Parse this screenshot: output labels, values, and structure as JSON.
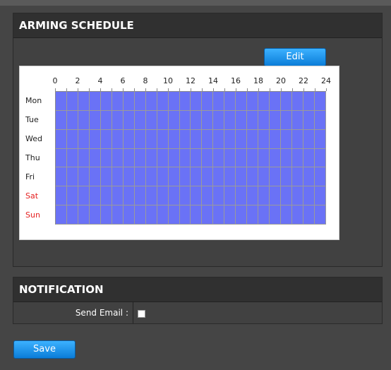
{
  "arming": {
    "title": "ARMING SCHEDULE",
    "edit_label": "Edit",
    "hours": [
      "0",
      "2",
      "4",
      "6",
      "8",
      "10",
      "12",
      "14",
      "16",
      "18",
      "20",
      "22",
      "24"
    ],
    "days": [
      {
        "label": "Mon",
        "weekend": false
      },
      {
        "label": "Tue",
        "weekend": false
      },
      {
        "label": "Wed",
        "weekend": false
      },
      {
        "label": "Thu",
        "weekend": false
      },
      {
        "label": "Fri",
        "weekend": false
      },
      {
        "label": "Sat",
        "weekend": true
      },
      {
        "label": "Sun",
        "weekend": true
      }
    ],
    "armed_color": "#6a72f6",
    "weekend_color": "#e52020"
  },
  "notification": {
    "title": "NOTIFICATION",
    "send_email_label": "Send Email :",
    "send_email_checked": false
  },
  "actions": {
    "save_label": "Save"
  }
}
